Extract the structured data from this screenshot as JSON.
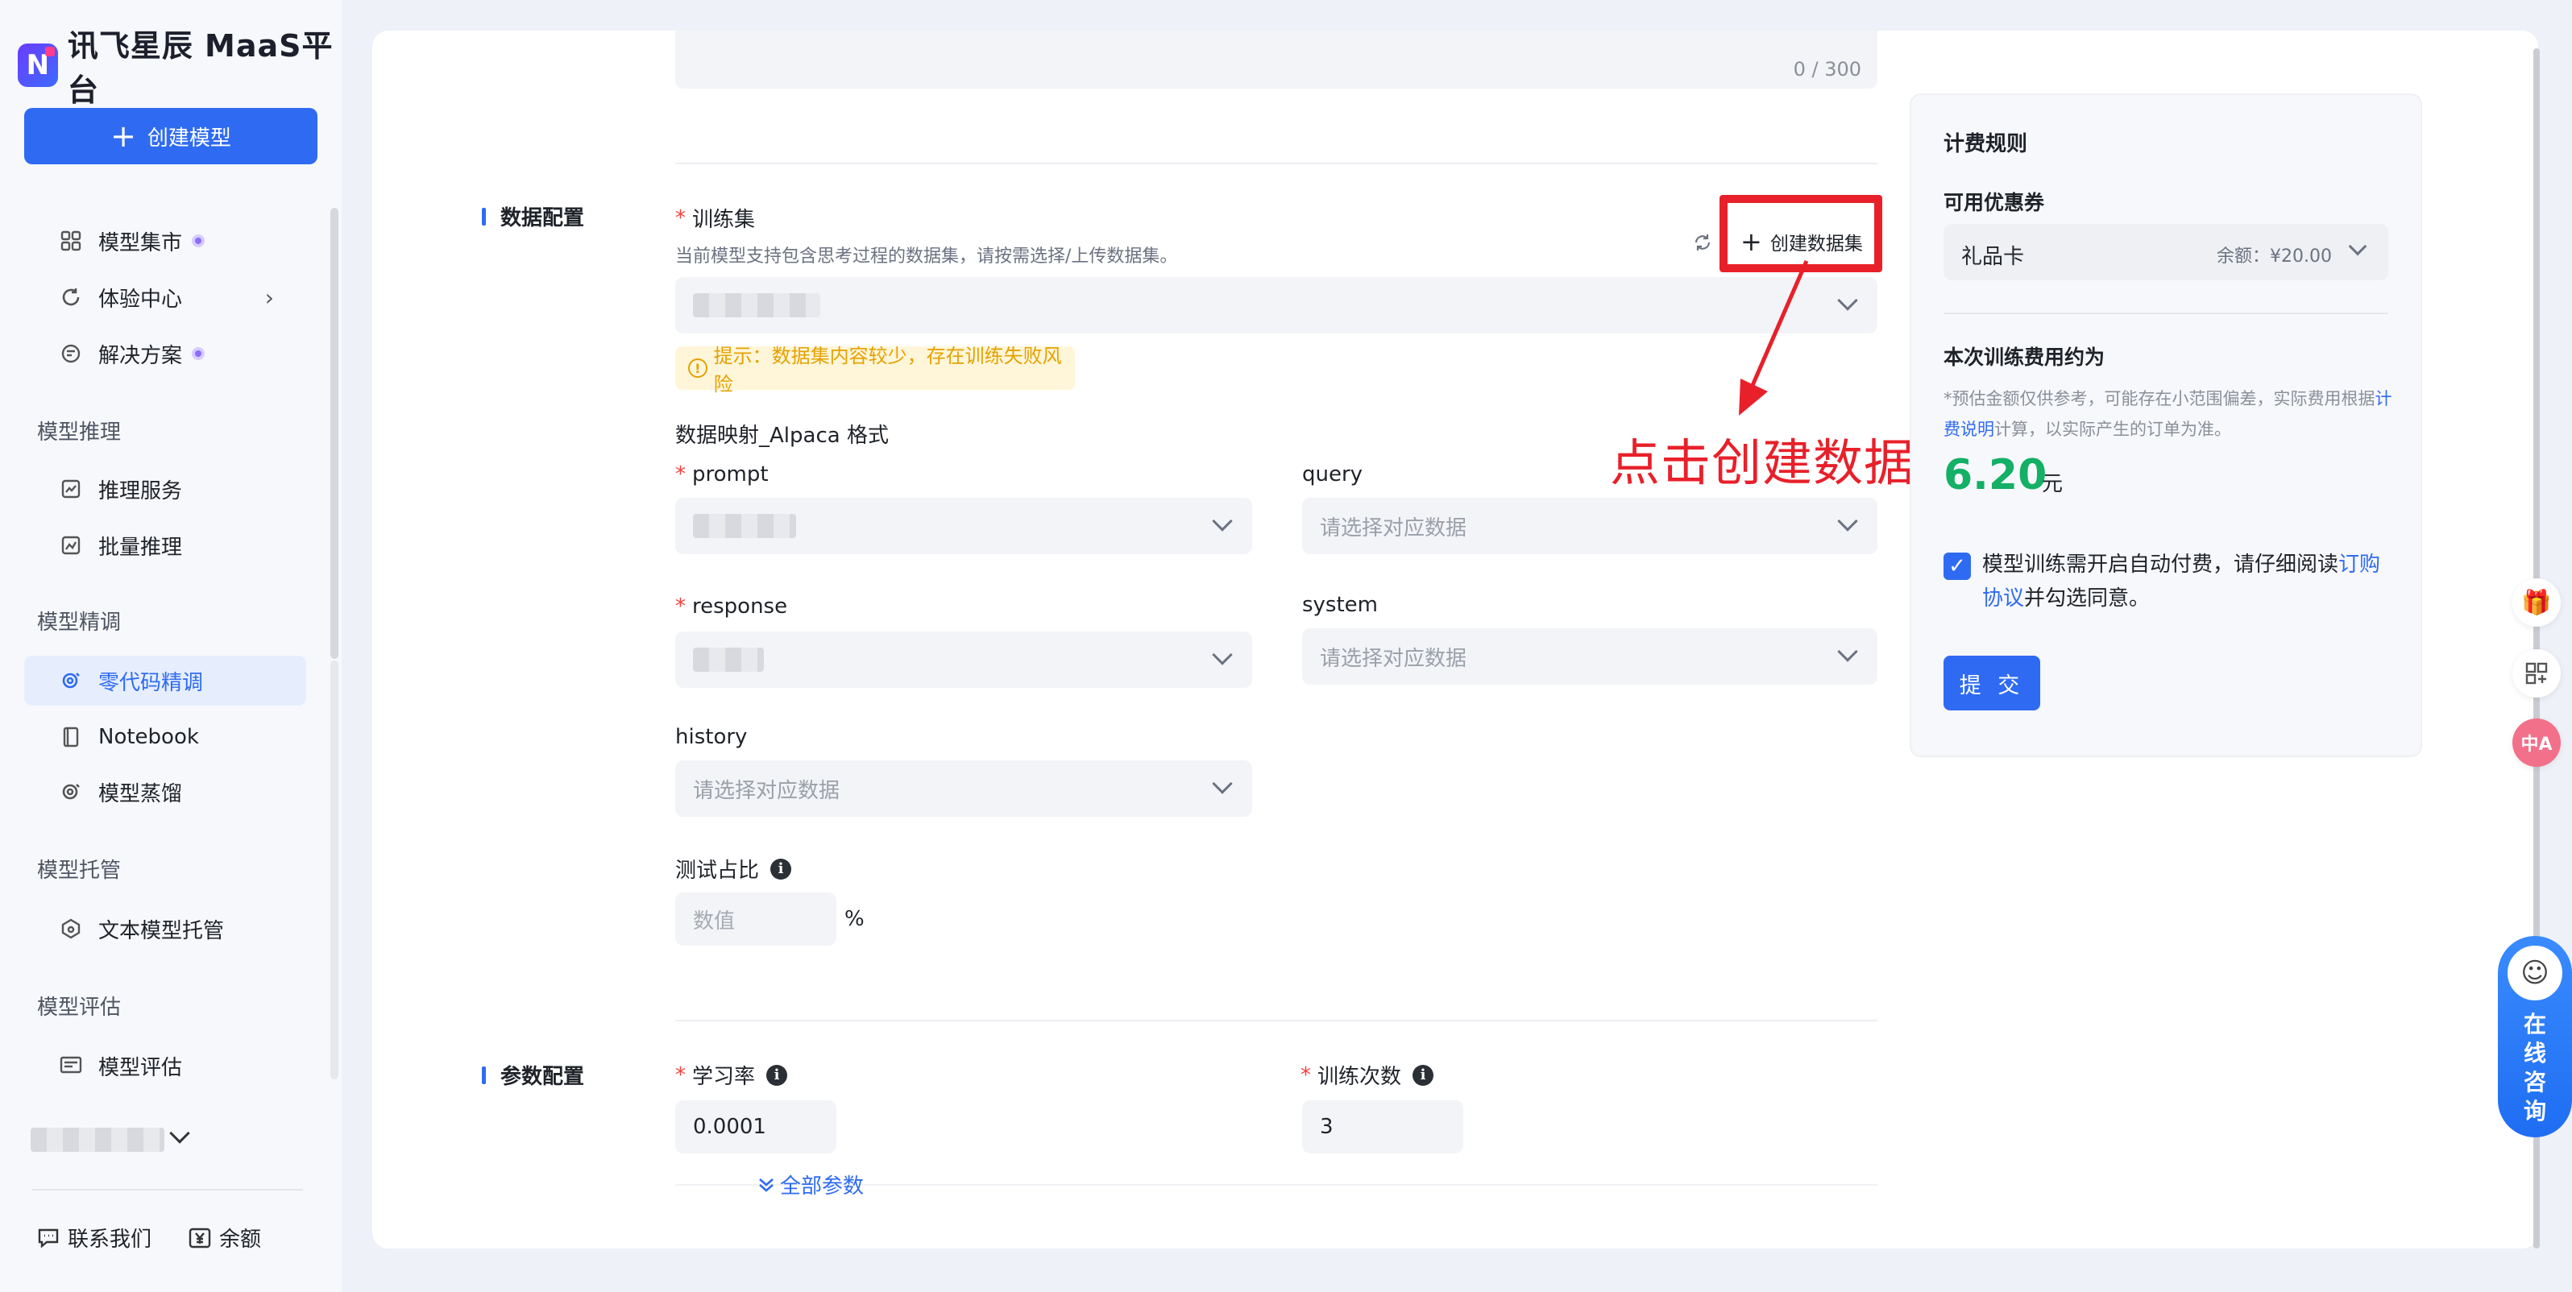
{
  "brand": {
    "name": "讯飞星辰 MaaS平台",
    "mark": "N"
  },
  "sidebar": {
    "create_model": "创建模型",
    "items": [
      {
        "label": "模型集市",
        "icon": "grid-icon"
      },
      {
        "label": "体验中心",
        "icon": "refresh-circle-icon"
      },
      {
        "label": "解决方案",
        "icon": "solution-icon"
      }
    ],
    "sections": {
      "inference": "模型推理",
      "inference_items": [
        "推理服务",
        "批量推理"
      ],
      "finetune": "模型精调",
      "finetune_items": [
        "零代码精调",
        "Notebook",
        "模型蒸馏"
      ],
      "hosting": "模型托管",
      "hosting_items": [
        "文本模型托管"
      ],
      "eval": "模型评估",
      "eval_items": [
        "模型评估"
      ]
    },
    "footer": {
      "contact": "联系我们",
      "balance": "余额"
    }
  },
  "form": {
    "desc_counter": "0 / 300",
    "data_config": {
      "section_title": "数据配置",
      "train_set_label": "训练集",
      "train_set_hint": "当前模型支持包含思考过程的数据集，请按需选择/上传数据集。",
      "create_dataset": "创建数据集",
      "warning": "提示：数据集内容较少，存在训练失败风险",
      "mapping_title": "数据映射_Alpaca 格式",
      "prompt_label": "prompt",
      "query_label": "query",
      "response_label": "response",
      "system_label": "system",
      "history_label": "history",
      "select_placeholder": "请选择对应数据",
      "test_ratio_label": "测试占比",
      "test_ratio_placeholder": "数值",
      "percent": "%"
    },
    "param_config": {
      "section_title": "参数配置",
      "lr_label": "学习率",
      "lr_value": "0.0001",
      "epochs_label": "训练次数",
      "epochs_value": "3",
      "all_params": "全部参数"
    }
  },
  "annotation": {
    "text": "点击创建数据集",
    "color": "#e8202a"
  },
  "billing": {
    "title": "计费规则",
    "coupon_label": "可用优惠券",
    "coupon_name": "礼品卡",
    "coupon_balance": "余额：¥20.00",
    "estimate_title": "本次训练费用约为",
    "estimate_note_1": "*预估金额仅供参考，可能存在小范围偏差，实际费用根据",
    "estimate_note_link": "计费说明",
    "estimate_note_2": "计算，以实际产生的订单为准。",
    "price": "6.20",
    "price_unit": "元",
    "agree_1": "模型训练需开启自动付费，请仔细阅读",
    "agree_link": "订购协议",
    "agree_2": "并勾选同意。",
    "submit": "提 交"
  },
  "float": {
    "consult": "在线咨询"
  },
  "colors": {
    "accent": "#2f6bf2",
    "price": "#13b066",
    "warning": "#e5a100"
  }
}
